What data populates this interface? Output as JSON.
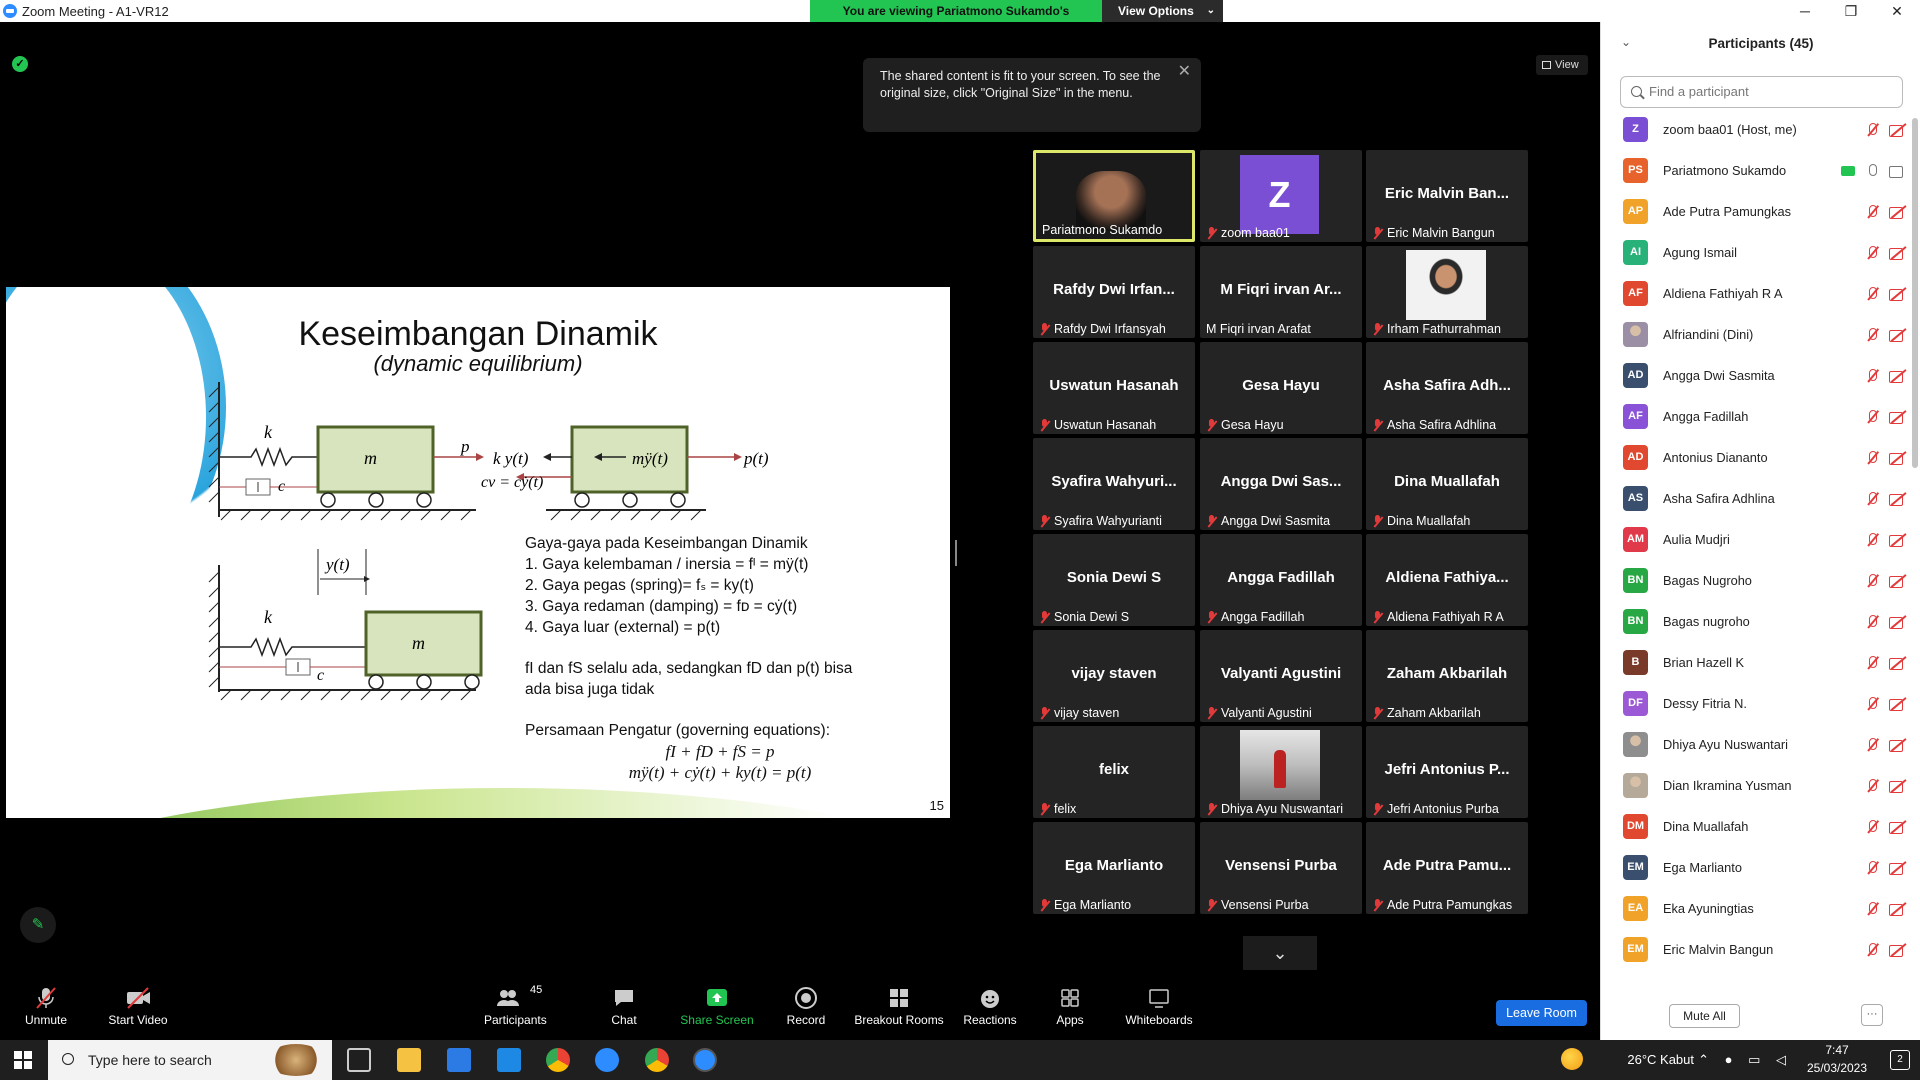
{
  "window": {
    "title": "Zoom Meeting - A1-VR12",
    "minimize": "─",
    "maximize": "❐",
    "close": "✕"
  },
  "banner": {
    "message": "You are viewing Pariatmono Sukamdo's screen",
    "view_options": "View Options"
  },
  "tooltip": {
    "text": "The shared content is fit to your screen. To see the original size, click \"Original Size\" in the menu."
  },
  "view_button": "View",
  "slide": {
    "title": "Keseimbangan Dinamik",
    "subtitle": "(dynamic equilibrium)",
    "diagram_labels": {
      "k1": "k",
      "m1": "m",
      "p": "p",
      "c1": "c",
      "ky": "k y(t)",
      "cv": "cv = cẏ(t)",
      "my": "mÿ(t)",
      "pt": "p(t)",
      "yt": "y(t)",
      "k2": "k",
      "m2": "m",
      "c2": "c"
    },
    "forces_heading": "Gaya-gaya pada Keseimbangan Dinamik",
    "forces": [
      "1.  Gaya kelembaman / inersia = fᴵ = mÿ(t)",
      "2.  Gaya pegas (spring)= fₛ = ky(t)",
      "3.  Gaya redaman (damping) = fᴅ = cẏ(t)",
      "4.  Gaya luar (external) = p(t)"
    ],
    "note_line1": "fI dan fS selalu ada, sedangkan fD dan p(t) bisa",
    "note_line2": "ada bisa juga tidak",
    "governing_heading": "Persamaan Pengatur (governing equations):",
    "eq1": "fI + fD + fS = p",
    "eq2": "mÿ(t) + cẏ(t) + ky(t) = p(t)",
    "page_number": "15"
  },
  "tiles": [
    {
      "name": "",
      "label": "Pariatmono Sukamdo",
      "kind": "video"
    },
    {
      "name": "Z",
      "label": "zoom baa01",
      "kind": "avatar"
    },
    {
      "name": "Eric Malvin Ban...",
      "label": "Eric Malvin Bangun",
      "kind": "name"
    },
    {
      "name": "Rafdy Dwi Irfan...",
      "label": "Rafdy Dwi Irfansyah",
      "kind": "name"
    },
    {
      "name": "M Fiqri irvan Ar...",
      "label": "M Fiqri irvan Arafat",
      "kind": "name"
    },
    {
      "name": "",
      "label": "Irham Fathurrahman",
      "kind": "photo"
    },
    {
      "name": "Uswatun Hasanah",
      "label": "Uswatun Hasanah",
      "kind": "name"
    },
    {
      "name": "Gesa Hayu",
      "label": "Gesa Hayu",
      "kind": "name"
    },
    {
      "name": "Asha Safira Adh...",
      "label": "Asha Safira Adhlina",
      "kind": "name"
    },
    {
      "name": "Syafira  Wahyuri...",
      "label": "Syafira Wahyurianti",
      "kind": "name"
    },
    {
      "name": "Angga Dwi Sas...",
      "label": "Angga Dwi Sasmita",
      "kind": "name"
    },
    {
      "name": "Dina Muallafah",
      "label": "Dina Muallafah",
      "kind": "name"
    },
    {
      "name": "Sonia Dewi S",
      "label": "Sonia Dewi S",
      "kind": "name"
    },
    {
      "name": "Angga Fadillah",
      "label": "Angga Fadillah",
      "kind": "name"
    },
    {
      "name": "Aldiena  Fathiya...",
      "label": "Aldiena Fathiyah R A",
      "kind": "name"
    },
    {
      "name": "vijay staven",
      "label": "vijay staven",
      "kind": "name"
    },
    {
      "name": "Valyanti Agustini",
      "label": "Valyanti Agustini",
      "kind": "name"
    },
    {
      "name": "Zaham Akbarilah",
      "label": "Zaham Akbarilah",
      "kind": "name"
    },
    {
      "name": "felix",
      "label": "felix",
      "kind": "name"
    },
    {
      "name": "",
      "label": "Dhiya Ayu Nuswantari",
      "kind": "photo2"
    },
    {
      "name": "Jefri Antonius P...",
      "label": "Jefri Antonius Purba",
      "kind": "name"
    },
    {
      "name": "Ega Marlianto",
      "label": "Ega Marlianto",
      "kind": "name"
    },
    {
      "name": "Vensensi Purba",
      "label": "Vensensi Purba",
      "kind": "name"
    },
    {
      "name": "Ade Putra Pamu...",
      "label": "Ade Putra Pamungkas",
      "kind": "name"
    }
  ],
  "toolbar": {
    "unmute": "Unmute",
    "start_video": "Start Video",
    "participants": "Participants",
    "participants_count": "45",
    "chat": "Chat",
    "share_screen": "Share Screen",
    "record": "Record",
    "breakout": "Breakout Rooms",
    "reactions": "Reactions",
    "apps": "Apps",
    "whiteboards": "Whiteboards",
    "leave": "Leave Room"
  },
  "panel": {
    "title": "Participants (45)",
    "search_placeholder": "Find a participant",
    "mute_all": "Mute All",
    "more": "···",
    "participants": [
      {
        "initials": "Z",
        "name": "zoom baa01 (Host, me)",
        "color": "#7b4fd3"
      },
      {
        "initials": "PS",
        "name": "Pariatmono Sukamdo",
        "color": "#e8622b",
        "sharing": true
      },
      {
        "initials": "AP",
        "name": "Ade Putra Pamungkas",
        "color": "#f0a328"
      },
      {
        "initials": "AI",
        "name": "Agung Ismail",
        "color": "#28b27a"
      },
      {
        "initials": "AF",
        "name": "Aldiena Fathiyah R A",
        "color": "#e0492f"
      },
      {
        "initials": "",
        "name": "Alfriandini (Dini)",
        "color": "#9a8fa5",
        "photo": true
      },
      {
        "initials": "AD",
        "name": "Angga Dwi Sasmita",
        "color": "#3a4f6e"
      },
      {
        "initials": "AF",
        "name": "Angga Fadillah",
        "color": "#8a52d6"
      },
      {
        "initials": "AD",
        "name": "Antonius Diananto",
        "color": "#e0492f"
      },
      {
        "initials": "AS",
        "name": "Asha Safira Adhlina",
        "color": "#3a4f6e"
      },
      {
        "initials": "AM",
        "name": "Aulia Mudjri",
        "color": "#e0394a"
      },
      {
        "initials": "BN",
        "name": "Bagas Nugroho",
        "color": "#28a745"
      },
      {
        "initials": "BN",
        "name": "Bagas nugroho",
        "color": "#28a745"
      },
      {
        "initials": "B",
        "name": "Brian Hazell K",
        "color": "#7a3a2a"
      },
      {
        "initials": "DF",
        "name": "Dessy Fitria N.",
        "color": "#9b59d6"
      },
      {
        "initials": "",
        "name": "Dhiya Ayu Nuswantari",
        "color": "#8e8e8e",
        "photo": true
      },
      {
        "initials": "",
        "name": "Dian Ikramina Yusman",
        "color": "#b5a99a",
        "photo": true
      },
      {
        "initials": "DM",
        "name": "Dina Muallafah",
        "color": "#e0492f"
      },
      {
        "initials": "EM",
        "name": "Ega Marlianto",
        "color": "#3a4f6e"
      },
      {
        "initials": "EA",
        "name": "Eka Ayuningtias",
        "color": "#f0a328"
      },
      {
        "initials": "EM",
        "name": "Eric Malvin Bangun",
        "color": "#f0a328"
      }
    ]
  },
  "taskbar": {
    "search": "Type here to search",
    "weather": "26°C  Kabut",
    "time": "7:47",
    "date": "25/03/2023",
    "notif": "2"
  }
}
